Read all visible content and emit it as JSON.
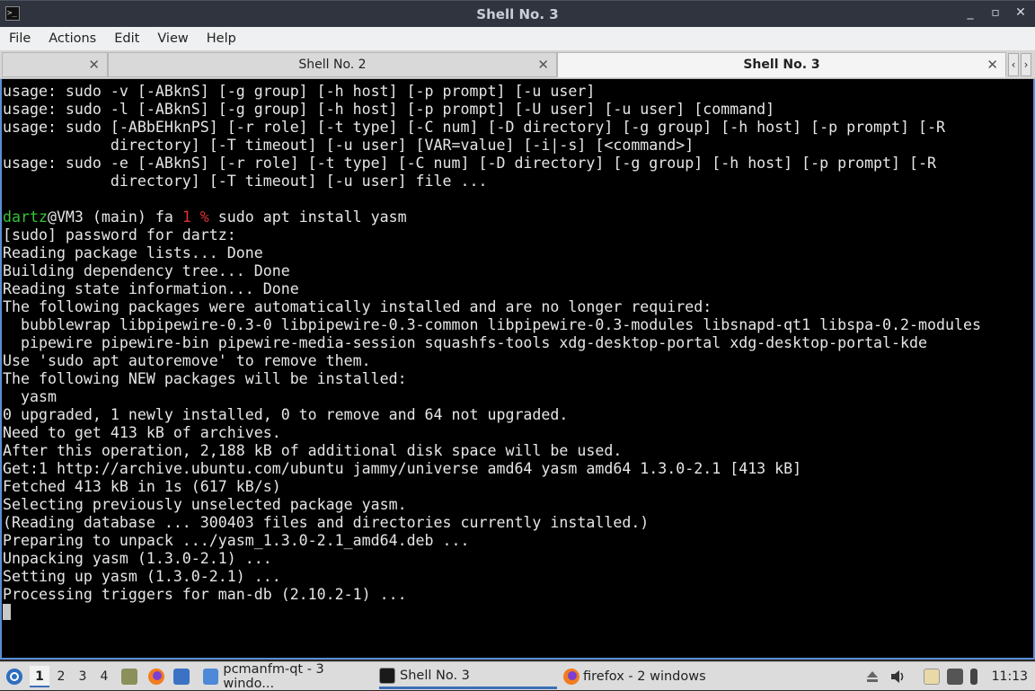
{
  "window": {
    "title": "Shell No. 3",
    "controls": [
      "_",
      "▫",
      "✕"
    ]
  },
  "menubar": [
    "File",
    "Actions",
    "Edit",
    "View",
    "Help"
  ],
  "tabs": [
    {
      "label": "",
      "close": "✕"
    },
    {
      "label": "Shell No. 2",
      "close": "✕"
    },
    {
      "label": "Shell No. 3",
      "close": "✕",
      "active": true
    }
  ],
  "tab_nav": {
    "left": "‹",
    "right": "›"
  },
  "terminal": {
    "lines": [
      "usage: sudo -v [-ABknS] [-g group] [-h host] [-p prompt] [-u user]",
      "usage: sudo -l [-ABknS] [-g group] [-h host] [-p prompt] [-U user] [-u user] [command]",
      "usage: sudo [-ABbEHknPS] [-r role] [-t type] [-C num] [-D directory] [-g group] [-h host] [-p prompt] [-R",
      "            directory] [-T timeout] [-u user] [VAR=value] [-i|-s] [<command>]",
      "usage: sudo -e [-ABknS] [-r role] [-t type] [-C num] [-D directory] [-g group] [-h host] [-p prompt] [-R",
      "            directory] [-T timeout] [-u user] file ...",
      ""
    ],
    "prompt": {
      "user": "dartz",
      "host_part": "@VM3 (main) fa ",
      "code": "1 %",
      "command": " sudo apt install yasm"
    },
    "output": [
      "[sudo] password for dartz:",
      "Reading package lists... Done",
      "Building dependency tree... Done",
      "Reading state information... Done",
      "The following packages were automatically installed and are no longer required:",
      "  bubblewrap libpipewire-0.3-0 libpipewire-0.3-common libpipewire-0.3-modules libsnapd-qt1 libspa-0.2-modules",
      "  pipewire pipewire-bin pipewire-media-session squashfs-tools xdg-desktop-portal xdg-desktop-portal-kde",
      "Use 'sudo apt autoremove' to remove them.",
      "The following NEW packages will be installed:",
      "  yasm",
      "0 upgraded, 1 newly installed, 0 to remove and 64 not upgraded.",
      "Need to get 413 kB of archives.",
      "After this operation, 2,188 kB of additional disk space will be used.",
      "Get:1 http://archive.ubuntu.com/ubuntu jammy/universe amd64 yasm amd64 1.3.0-2.1 [413 kB]",
      "Fetched 413 kB in 1s (617 kB/s)",
      "Selecting previously unselected package yasm.",
      "(Reading database ... 300403 files and directories currently installed.)",
      "Preparing to unpack .../yasm_1.3.0-2.1_amd64.deb ...",
      "Unpacking yasm (1.3.0-2.1) ...",
      "Setting up yasm (1.3.0-2.1) ...",
      "Processing triggers for man-db (2.10.2-1) ..."
    ]
  },
  "taskbar": {
    "desktops": [
      "1",
      "2",
      "3",
      "4"
    ],
    "windows": [
      {
        "label": "pcmanfm-qt - 3 windo...",
        "icon": "folder-icon"
      },
      {
        "label": "Shell No. 3",
        "icon": "terminal-icon",
        "active": true
      },
      {
        "label": "firefox - 2 windows",
        "icon": "firefox-icon"
      }
    ],
    "clock": "11:13"
  }
}
